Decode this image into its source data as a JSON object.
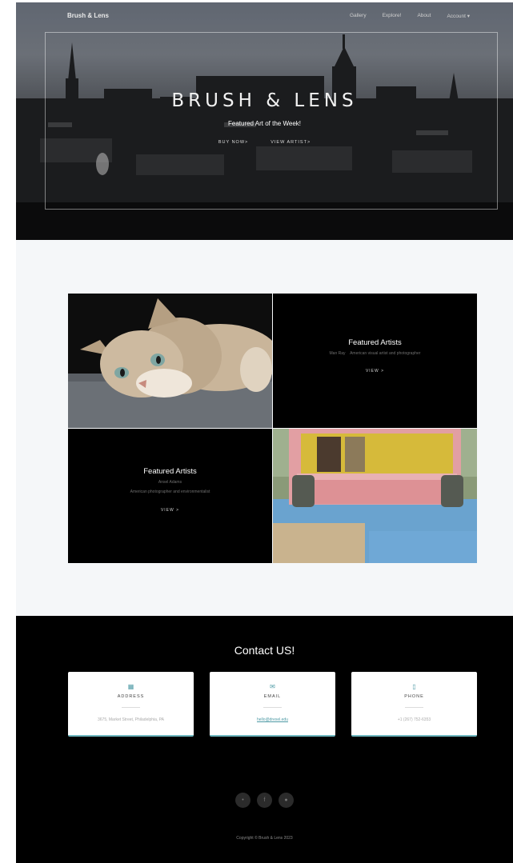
{
  "nav": {
    "brand": "Brush & Lens",
    "links": [
      "Gallery",
      "Explore!",
      "About",
      "Account ▾"
    ]
  },
  "hero": {
    "title": "BRUSH & LENS",
    "subtitle": "Featured Art of the Week!",
    "buy_now": "BUY NOW>",
    "view_artist": "VIEW ARTIST>"
  },
  "featured": {
    "top": {
      "title": "Featured Artists",
      "artist": "Man Ray",
      "description": "American visual artist and photographer",
      "view": "VIEW >"
    },
    "bottom": {
      "title": "Featured Artists",
      "artist": "Ansel Adams",
      "description": "American photographer and environmentalist",
      "view": "VIEW >"
    }
  },
  "contact": {
    "title": "Contact US!",
    "address": {
      "label": "ADDRESS",
      "value": "3675, Market Street, Philadelphia, PA",
      "icon": "building-icon"
    },
    "email": {
      "label": "EMAIL",
      "value": "hello@drexel.edu",
      "icon": "envelope-icon"
    },
    "phone": {
      "label": "PHONE",
      "value": "+1 (267) 752-6353",
      "icon": "mobile-icon"
    }
  },
  "social": [
    "twitter-icon",
    "facebook-icon",
    "github-icon"
  ],
  "footer": {
    "copyright": "Copyright © Brush & Lens 2023"
  },
  "colors": {
    "accent": "#4e9aa5",
    "dark": "#000000",
    "section_bg": "#f5f7f9"
  }
}
